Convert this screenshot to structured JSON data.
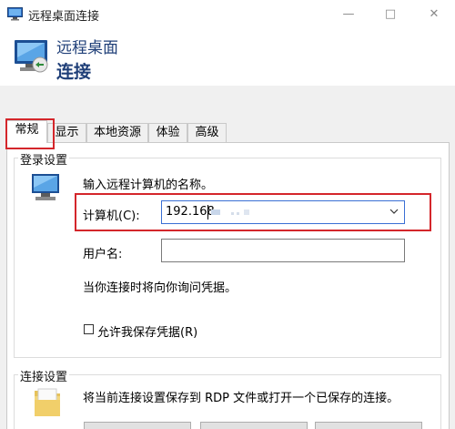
{
  "window": {
    "title": "远程桌面连接",
    "controls": {
      "minimize": "—",
      "maximize": "□",
      "close": "✕"
    }
  },
  "banner": {
    "line1": "远程桌面",
    "line2": "连接"
  },
  "tabs": [
    {
      "label": "常规",
      "active": true
    },
    {
      "label": "显示",
      "active": false
    },
    {
      "label": "本地资源",
      "active": false
    },
    {
      "label": "体验",
      "active": false
    },
    {
      "label": "高级",
      "active": false
    }
  ],
  "logon": {
    "group_label": "登录设置",
    "instruction": "输入远程计算机的名称。",
    "computer_label": "计算机(C):",
    "computer_value": "192.168",
    "username_label": "用户名:",
    "username_value": "",
    "credentials_note": "当你连接时将向你询问凭据。",
    "save_credentials_label": "允许我保存凭据(R)",
    "save_credentials_checked": false
  },
  "connection": {
    "group_label": "连接设置",
    "description": "将当前连接设置保存到 RDP 文件或打开一个已保存的连接。"
  },
  "colors": {
    "highlight_box": "#d4262b",
    "focus_border": "#3a6fd4",
    "banner_text": "#1f3f78"
  }
}
